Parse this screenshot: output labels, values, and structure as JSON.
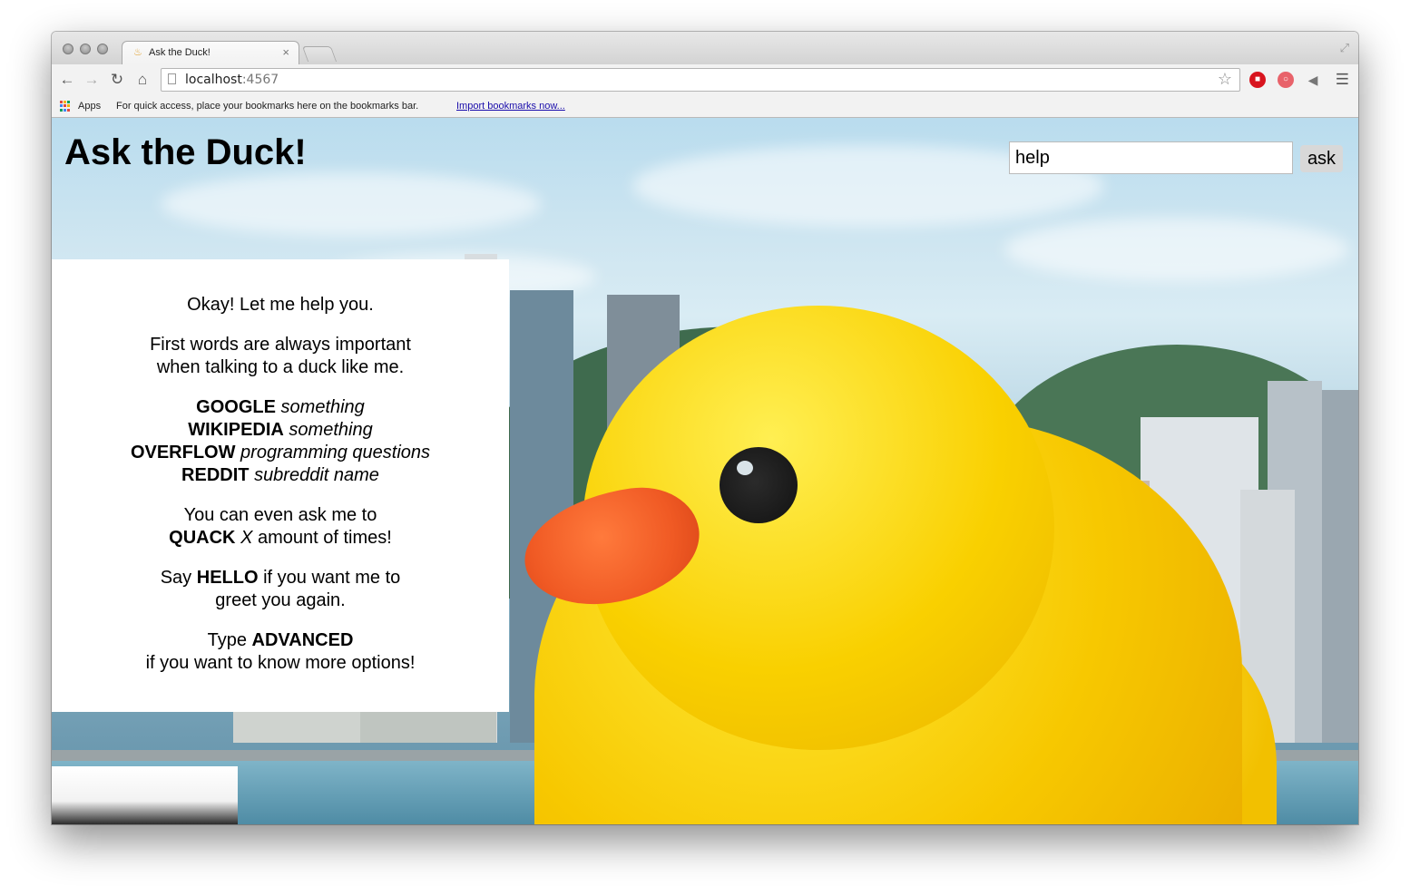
{
  "browser": {
    "tab_title": "Ask the Duck!",
    "tab_close": "×",
    "url_host": "localhost",
    "url_port": ":4567",
    "bookmarks": {
      "apps_label": "Apps",
      "message": "For quick access, place your bookmarks here on the bookmarks bar.",
      "import_link": "Import bookmarks now..."
    },
    "icons": [
      "back-arrow-icon",
      "forward-arrow-icon",
      "reload-icon",
      "home-icon",
      "star-icon",
      "menu-icon",
      "fullscreen-icon"
    ]
  },
  "page": {
    "title": "Ask the Duck!",
    "search": {
      "value": "help",
      "button_label": "ask"
    },
    "response": {
      "intro": "Okay! Let me help you.",
      "first_words_line1": "First words are always important",
      "first_words_line2": "when talking to a duck like me.",
      "commands": [
        {
          "keyword": "GOOGLE",
          "arg": "something"
        },
        {
          "keyword": "WIKIPEDIA",
          "arg": "something"
        },
        {
          "keyword": "OVERFLOW",
          "arg": "programming questions"
        },
        {
          "keyword": "REDDIT",
          "arg": "subreddit name"
        }
      ],
      "quack_line1": "You can even ask me to",
      "quack_keyword": "QUACK",
      "quack_var": "X",
      "quack_rest": "amount of times!",
      "hello_prefix": "Say",
      "hello_keyword": "HELLO",
      "hello_suffix": "if you want me to",
      "hello_line2": "greet you again.",
      "advanced_prefix": "Type",
      "advanced_keyword": "ADVANCED",
      "advanced_line2": "if you want to know more options!"
    }
  },
  "colors": {
    "duck_yellow": "#f9d000",
    "beak_orange": "#f05a24",
    "panel_background": "#ffffff",
    "button_background": "#d8d8d8"
  }
}
